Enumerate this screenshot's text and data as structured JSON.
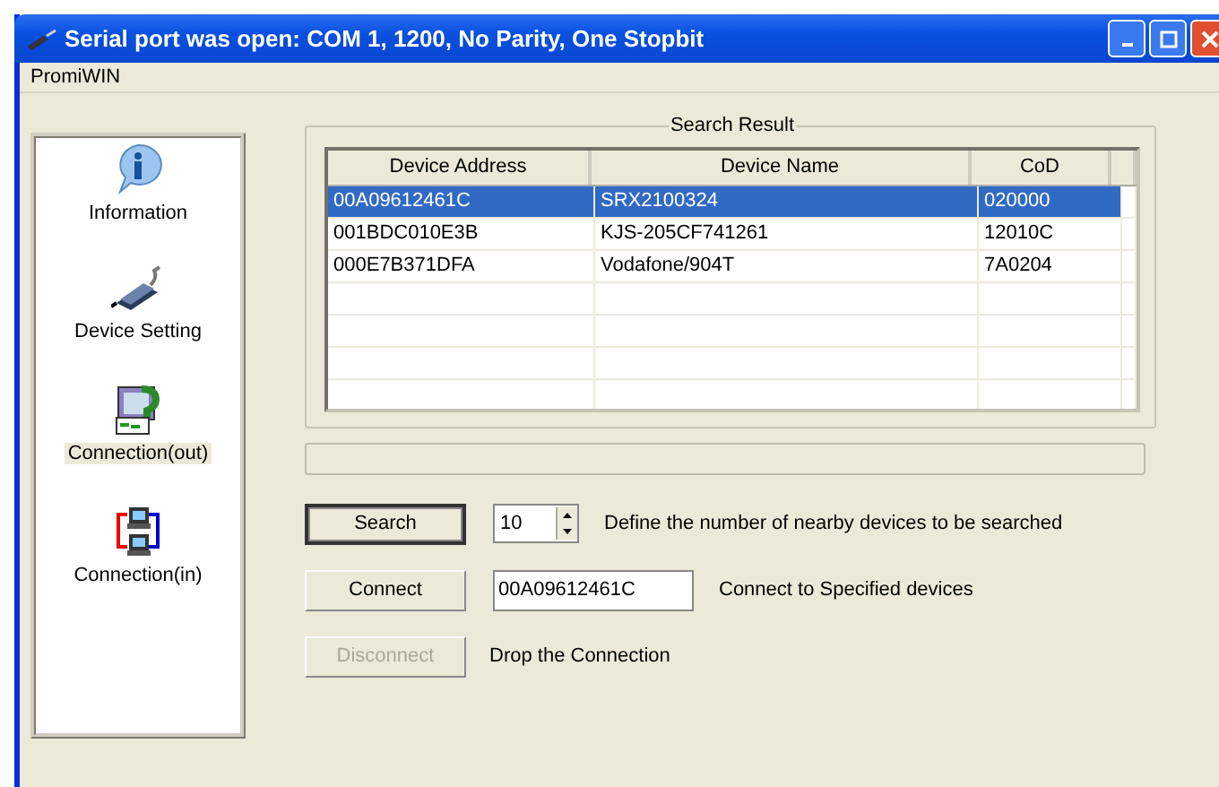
{
  "window": {
    "title": "Serial port was open: COM 1, 1200, No Parity, One Stopbit"
  },
  "menu": [
    "PromiWIN"
  ],
  "sidebar": {
    "items": [
      {
        "kind": "info",
        "label": "Information",
        "selected": false
      },
      {
        "kind": "device",
        "label": "Device Setting",
        "selected": false
      },
      {
        "kind": "out",
        "label": "Connection(out)",
        "selected": true
      },
      {
        "kind": "in",
        "label": "Connection(in)",
        "selected": false
      }
    ]
  },
  "search_result": {
    "title": "Search Result",
    "columns": [
      "Device Address",
      "Device Name",
      "CoD"
    ],
    "rows": [
      {
        "cells": [
          "00A09612461C",
          "SRX2100324",
          "020000"
        ],
        "selected": true
      },
      {
        "cells": [
          "001BDC010E3B",
          "KJS-205CF741261",
          "12010C"
        ],
        "selected": false
      },
      {
        "cells": [
          "000E7B371DFA",
          "Vodafone/904T",
          "7A0204"
        ],
        "selected": false
      }
    ]
  },
  "controls": [
    {
      "kind": "spin",
      "button": "Search",
      "value": "10",
      "description": "Define the number of nearby devices to be searched",
      "disabled": false,
      "default": true
    },
    {
      "kind": "field",
      "button": "Connect",
      "value": "00A09612461C",
      "description": "Connect to Specified devices",
      "disabled": false,
      "default": false
    },
    {
      "kind": "none",
      "button": "Disconnect",
      "description": "Drop the Connection",
      "disabled": true,
      "default": false
    }
  ]
}
